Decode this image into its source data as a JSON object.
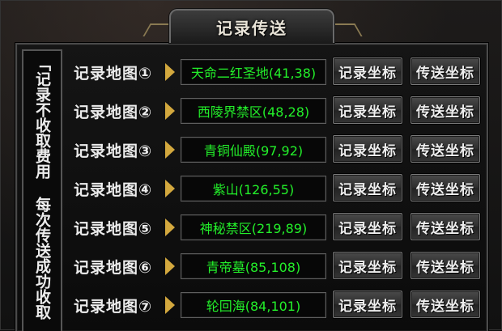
{
  "window": {
    "title": "记录传送"
  },
  "notice": {
    "text": "「记录不收取费用 每次传送成功收取"
  },
  "rows": [
    {
      "label": "记录地图①",
      "location": "天命二红圣地(41,38)",
      "record_label": "记录坐标",
      "teleport_label": "传送坐标"
    },
    {
      "label": "记录地图②",
      "location": "西陵界禁区(48,28)",
      "record_label": "记录坐标",
      "teleport_label": "传送坐标"
    },
    {
      "label": "记录地图③",
      "location": "青铜仙殿(97,92)",
      "record_label": "记录坐标",
      "teleport_label": "传送坐标"
    },
    {
      "label": "记录地图④",
      "location": "紫山(126,55)",
      "record_label": "记录坐标",
      "teleport_label": "传送坐标"
    },
    {
      "label": "记录地图⑤",
      "location": "神秘禁区(219,89)",
      "record_label": "记录坐标",
      "teleport_label": "传送坐标"
    },
    {
      "label": "记录地图⑥",
      "location": "青帝墓(85,108)",
      "record_label": "记录坐标",
      "teleport_label": "传送坐标"
    },
    {
      "label": "记录地图⑦",
      "location": "轮回海(84,101)",
      "record_label": "记录坐标",
      "teleport_label": "传送坐标"
    }
  ],
  "colors": {
    "location_text": "#23f02a",
    "arrow": "#d3a83e",
    "label_text": "#ececec"
  },
  "icons": {
    "row_marker": "triangle-right-arrow-icon"
  }
}
